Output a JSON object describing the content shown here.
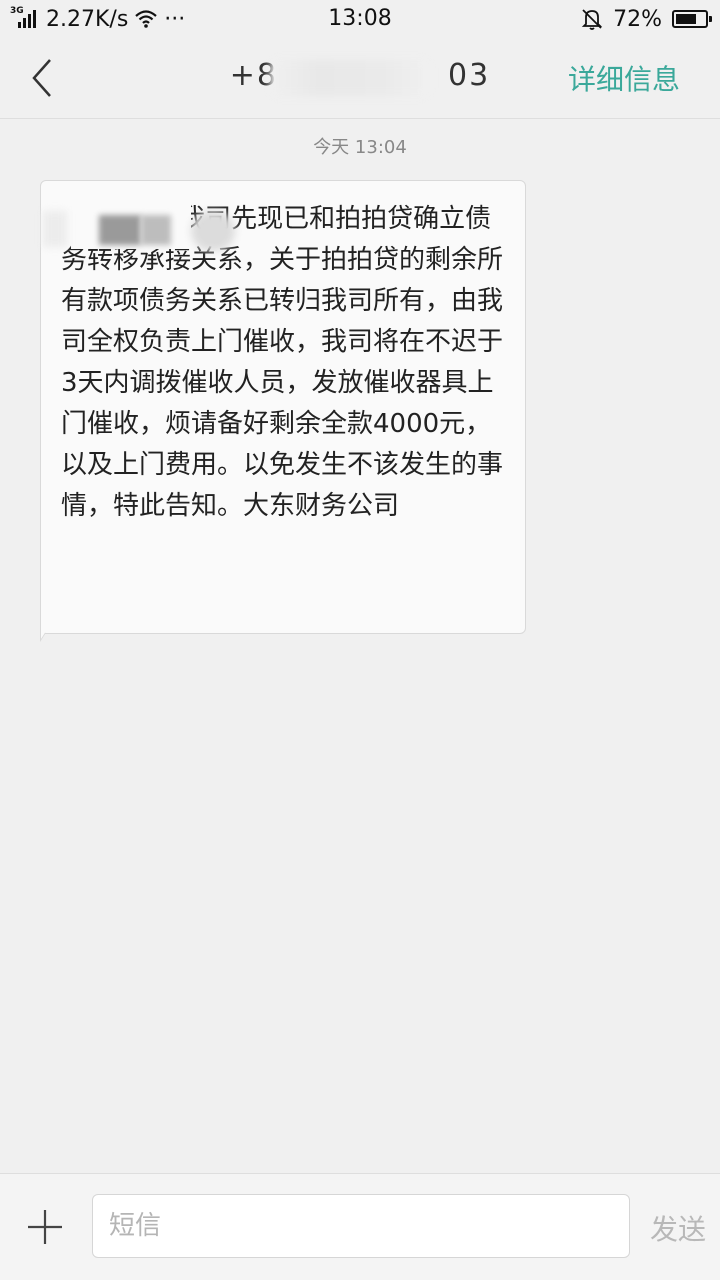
{
  "status_bar": {
    "network_type": "3G",
    "net_speed": "2.27K/s",
    "more": "···",
    "time": "13:08",
    "battery_percent": "72%",
    "battery_level": 0.72
  },
  "header": {
    "contact_left": "+8",
    "contact_right": "03",
    "details_label": "详细信息"
  },
  "conversation": {
    "date_separator": "今天  13:04",
    "message": "        是，我司先现已和拍拍贷确立债务转移承接关系，关于拍拍贷的剩余所有款项债务关系已转归我司所有，由我司全权负责上门催收，我司将在不迟于3天内调拨催收人员，发放催收器具上门催收，烦请备好剩余全款4000元，以及上门费用。以免发生不该发生的事情，特此告知。大东财务公司"
  },
  "input_bar": {
    "placeholder": "短信",
    "send_label": "发送"
  },
  "icons": {
    "back": "chevron-left-icon",
    "add": "plus-icon",
    "wifi": "wifi-icon",
    "bell": "bell-off-icon"
  }
}
